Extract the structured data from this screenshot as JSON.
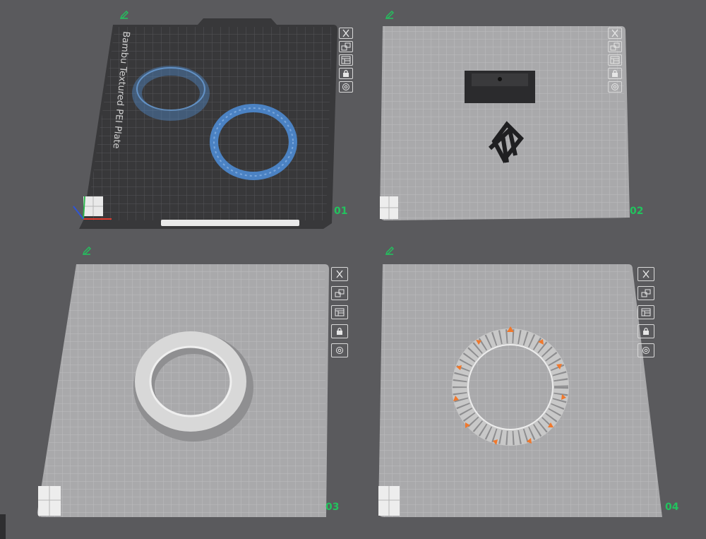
{
  "plates": [
    {
      "number": "01",
      "label": "Bambu Textured PEI Plate",
      "theme": "dark"
    },
    {
      "number": "02",
      "theme": "light"
    },
    {
      "number": "03",
      "theme": "light"
    },
    {
      "number": "04",
      "theme": "light"
    }
  ],
  "tools": [
    {
      "name": "close-icon"
    },
    {
      "name": "arrange-icon"
    },
    {
      "name": "layout-icon"
    },
    {
      "name": "lock-icon"
    },
    {
      "name": "settings-icon"
    }
  ],
  "colors": {
    "background": "#5a5a5d",
    "plate_dark": "#38383a",
    "plate_light": "#a9a9ab",
    "accent_green": "#22c35e",
    "model_blue": "#4b82c3",
    "model_gray": "#d3d3d3",
    "support_orange": "#f0782c"
  }
}
